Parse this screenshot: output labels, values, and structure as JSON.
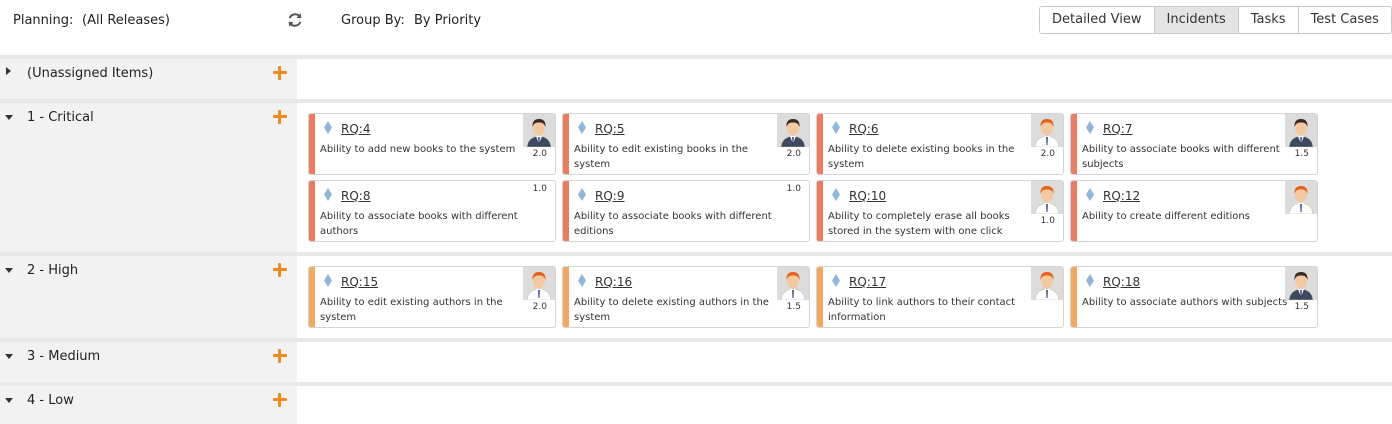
{
  "toolbar": {
    "planning_label": "Planning:",
    "planning_value": "(All Releases)",
    "groupby_label": "Group By:",
    "groupby_value": "By Priority",
    "views": [
      "Detailed View",
      "Incidents",
      "Tasks",
      "Test Cases"
    ],
    "active_view": "Incidents"
  },
  "colors": {
    "critical": "#f07a5f",
    "high": "#f5a85c",
    "plus": "#f08a1c",
    "diamond": "#8fb6dc"
  },
  "rows": [
    {
      "title": "(Unassigned Items)"
    },
    {
      "title": "1 - Critical"
    },
    {
      "title": "2 - High"
    },
    {
      "title": "3 - Medium"
    },
    {
      "title": "4 - Low"
    }
  ],
  "cards": [
    {
      "id": "RQ:4",
      "desc": "Ability to add new books to the system",
      "estimate": "2.0",
      "avatar": "male-dark-hair"
    },
    {
      "id": "RQ:5",
      "desc": "Ability to edit existing books in the system",
      "estimate": "2.0",
      "avatar": "male-dark-hair"
    },
    {
      "id": "RQ:6",
      "desc": "Ability to delete existing books in the system",
      "estimate": "2.0",
      "avatar": "male-red-hair"
    },
    {
      "id": "RQ:7",
      "desc": "Ability to associate books with different subjects",
      "estimate": "1.5",
      "avatar": "male-dark-hair"
    },
    {
      "id": "RQ:8",
      "desc": "Ability to associate books with different authors",
      "estimate": "1.0",
      "avatar": ""
    },
    {
      "id": "RQ:9",
      "desc": "Ability to associate books with different editions",
      "estimate": "1.0",
      "avatar": ""
    },
    {
      "id": "RQ:10",
      "desc": "Ability to completely erase all books stored in the system with one click",
      "estimate": "1.0",
      "avatar": "male-red-hair"
    },
    {
      "id": "RQ:12",
      "desc": "Ability to create different editions",
      "estimate": "",
      "avatar": "male-red-hair"
    },
    {
      "id": "RQ:15",
      "desc": "Ability to edit existing authors in the system",
      "estimate": "2.0",
      "avatar": "male-red-hair"
    },
    {
      "id": "RQ:16",
      "desc": "Ability to delete existing authors in the system",
      "estimate": "1.5",
      "avatar": "male-red-hair"
    },
    {
      "id": "RQ:17",
      "desc": "Ability to link authors to their contact information",
      "estimate": "",
      "avatar": "male-red-hair"
    },
    {
      "id": "RQ:18",
      "desc": "Ability to associate authors with subjects",
      "estimate": "1.5",
      "avatar": "male-dark-hair"
    }
  ]
}
